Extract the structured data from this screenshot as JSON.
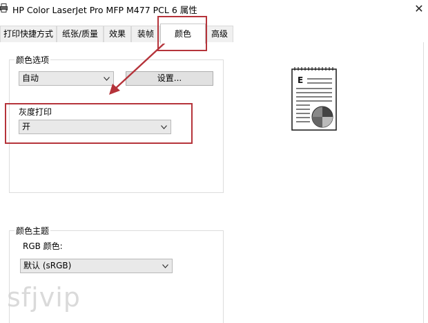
{
  "window": {
    "title": "HP Color LaserJet Pro MFP M477 PCL 6 属性",
    "close_glyph": "✕"
  },
  "tabs": [
    {
      "label": "打印快捷方式"
    },
    {
      "label": "纸张/质量"
    },
    {
      "label": "效果"
    },
    {
      "label": "装帧"
    },
    {
      "label": "颜色"
    },
    {
      "label": "高级"
    }
  ],
  "color_options": {
    "group_label": "颜色选项",
    "mode_value": "自动",
    "settings_button": "设置..."
  },
  "grayscale": {
    "label": "灰度打印",
    "value": "开"
  },
  "color_theme": {
    "group_label": "颜色主题",
    "rgb_label": "RGB 颜色:",
    "rgb_value": "默认 (sRGB)"
  },
  "preview": {
    "letter": "E"
  },
  "watermark": "sfjvip",
  "colors": {
    "annotation": "#b5333a"
  }
}
